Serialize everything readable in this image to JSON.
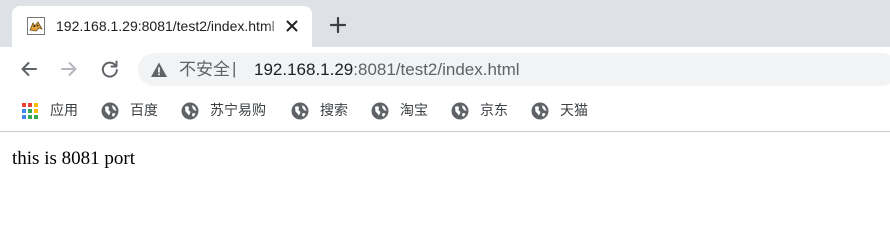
{
  "tab": {
    "title": "192.168.1.29:8081/test2/index.html",
    "favicon": "tomcat-icon"
  },
  "toolbar": {
    "back": "arrow-left-icon",
    "forward": "arrow-right-icon",
    "reload": "reload-icon"
  },
  "omnibox": {
    "security_icon": "warning-icon",
    "security_label": "不安全",
    "separator": "|",
    "url_host": "192.168.1.29",
    "url_rest": ":8081/test2/index.html"
  },
  "bookmarks": {
    "apps_label": "应用",
    "items": [
      {
        "label": "百度",
        "icon": "globe-icon"
      },
      {
        "label": "苏宁易购",
        "icon": "globe-icon"
      },
      {
        "label": "搜索",
        "icon": "globe-icon"
      },
      {
        "label": "淘宝",
        "icon": "globe-icon"
      },
      {
        "label": "京东",
        "icon": "globe-icon"
      },
      {
        "label": "天猫",
        "icon": "globe-icon"
      }
    ]
  },
  "page": {
    "text": "this is 8081 port"
  },
  "colors": {
    "tabstrip_bg": "#dee1e6",
    "omnibox_bg": "#f1f3f4",
    "icon_gray": "#5f6368"
  }
}
